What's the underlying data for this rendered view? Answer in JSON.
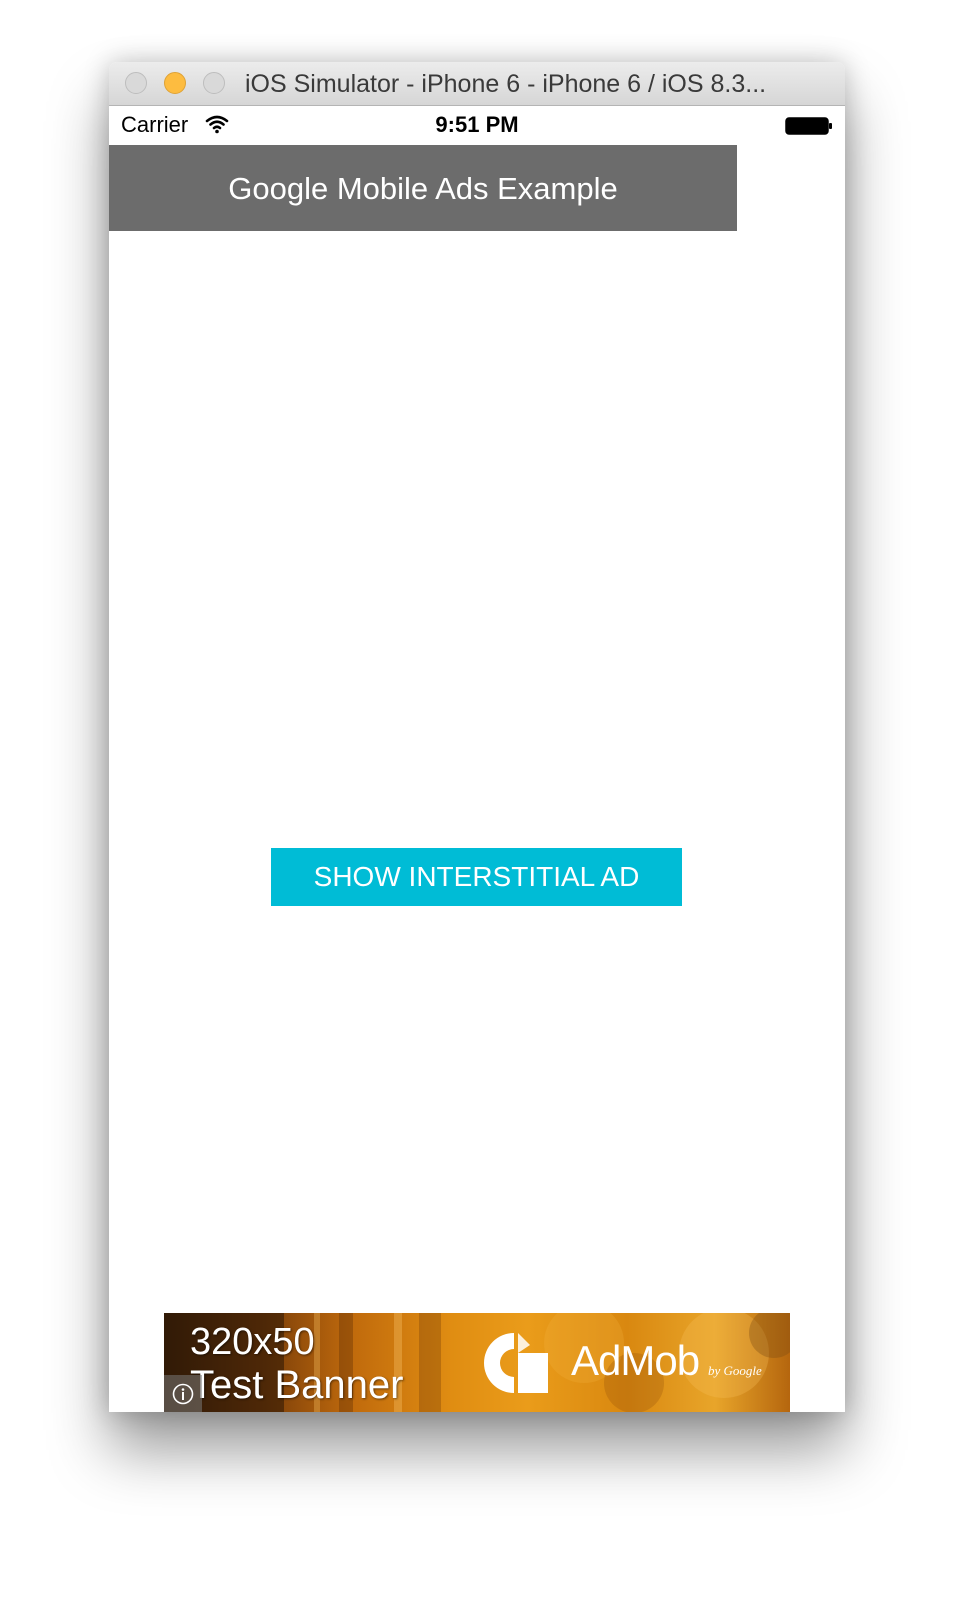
{
  "window": {
    "title": "iOS Simulator - iPhone 6 - iPhone 6 / iOS 8.3..."
  },
  "status_bar": {
    "carrier": "Carrier",
    "time": "9:51 PM",
    "wifi_icon": "wifi-icon",
    "battery_icon": "battery-icon"
  },
  "app": {
    "header_title": "Google Mobile Ads Example",
    "main_button_label": "SHOW INTERSTITIAL AD"
  },
  "ad_banner": {
    "size_text": "320x50",
    "label": "Test Banner",
    "brand": "AdMob",
    "brand_suffix": "by Google",
    "info_icon": "info-icon"
  },
  "colors": {
    "header_bg": "#6c6c6c",
    "button_bg": "#00bcd6",
    "minimize_light": "#fdbc40"
  }
}
